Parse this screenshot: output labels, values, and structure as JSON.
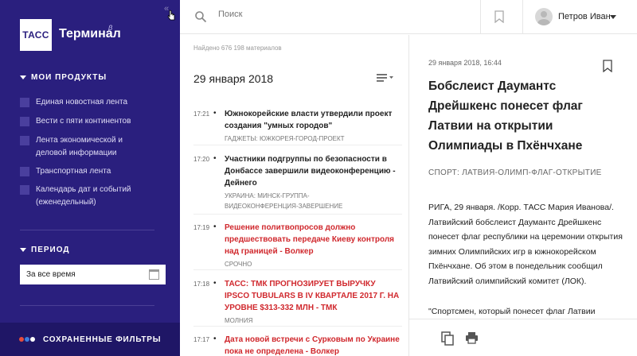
{
  "sidebar": {
    "logo": "ТАСС",
    "app_name": "Терминал",
    "beta": "β",
    "collapse": "«",
    "products_header": "МОИ ПРОДУКТЫ",
    "products": [
      {
        "label": "Единая новостная лента"
      },
      {
        "label": "Вести с пяти континентов"
      },
      {
        "label": "Лента экономической и деловой информации"
      },
      {
        "label": "Транспортная лента"
      },
      {
        "label": "Календарь дат и событий (еженедельный)"
      }
    ],
    "period_header": "ПЕРИОД",
    "period_value": "За все время",
    "saved_filters": "СОХРАНЕННЫЕ ФИЛЬТРЫ",
    "saved_dots_colors": [
      "#e74c3c",
      "#3b7ddd",
      "#ffffff"
    ]
  },
  "topbar": {
    "search_placeholder": "Поиск",
    "user_name": "Петров Иван"
  },
  "feed": {
    "found": "Найдено 676 198 материалов",
    "date": "29 января 2018",
    "items": [
      {
        "time": "17:21",
        "title": "Южнокорейские власти утвердили проект создания \"умных городов\"",
        "tag": "ГАДЖЕТЫ: ЮЖКОРЕЯ-ГОРОД-ПРОЕКТ",
        "urgent": false
      },
      {
        "time": "17:20",
        "title": "Участники подгруппы по безопасности в Донбассе завершили видеоконференцию - Дейнего",
        "tag": "УКРАИНА: МИНСК-ГРУППА-ВИДЕОКОНФЕРЕНЦИЯ-ЗАВЕРШЕНИЕ",
        "urgent": false
      },
      {
        "time": "17:19",
        "title": "Решение политвопросов должно предшествовать передаче Киеву контроля над границей - Волкер",
        "tag": "СРОЧНО",
        "urgent": true
      },
      {
        "time": "17:18",
        "title": "ТАСС: ТМК ПРОГНОЗИРУЕТ ВЫРУЧКУ IPSCO TUBULARS В IV КВАРТАЛЕ 2017 Г. НА УРОВНЕ $313-332 МЛН - ТМК",
        "tag": "МОЛНИЯ",
        "urgent": true
      },
      {
        "time": "17:17",
        "title": "Дата новой встречи с Сурковым по Украине пока не определена - Волкер",
        "tag": "",
        "urgent": true
      }
    ]
  },
  "article": {
    "time": "29 января 2018, 16:44",
    "title": "Бобслеист Даумантс Дрейшкенс понесет флаг Латвии на открытии Олимпиады в Пхёнчхане",
    "tags": "СПОРТ: ЛАТВИЯ-ОЛИМП-ФЛАГ-ОТКРЫТИЕ",
    "body": "РИГА, 29 января. /Корр. ТАСС Мария Иванова/. Латвийский бобслеист Даумантс Дрейшкенс понесет флаг республики на церемонии открытия зимних Олимпийских игр в южнокорейском Пхёнчхане. Об этом в понедельник сообщил Латвийский олимпийский комитет (ЛОК).",
    "quote": "\"Спортсмен, который понесет флаг Латвии"
  }
}
